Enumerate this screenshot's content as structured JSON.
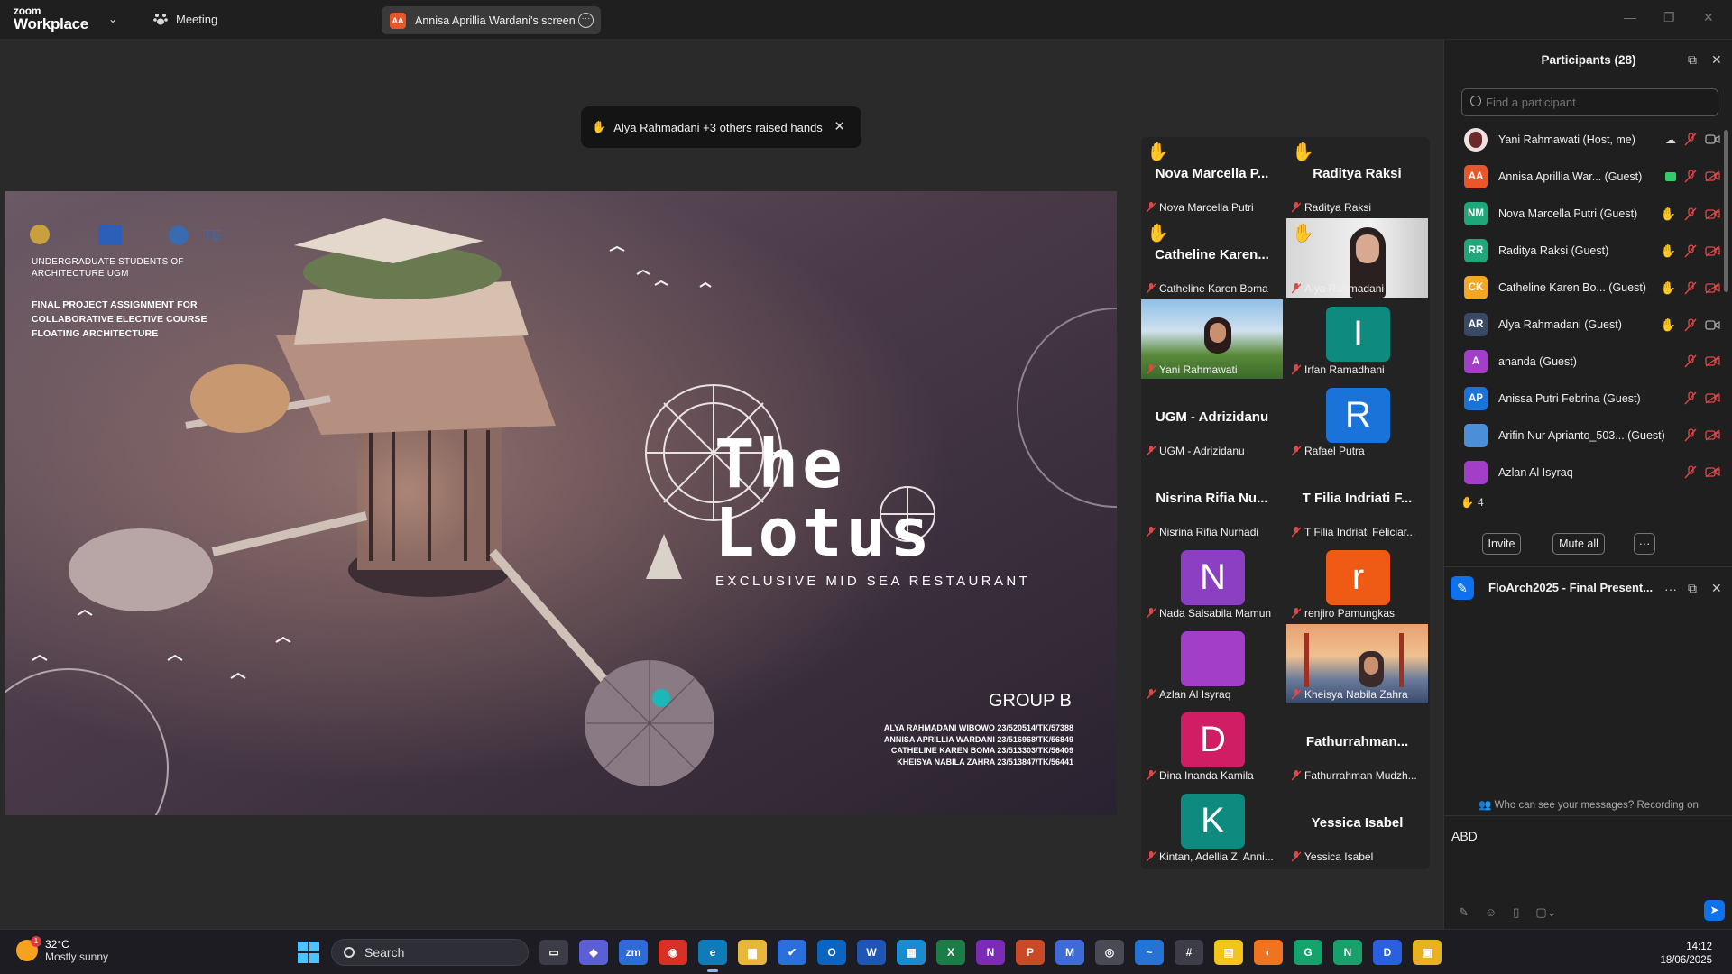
{
  "topbar": {
    "logo_line1": "zoom",
    "logo_line2": "Workplace",
    "meeting_label": "Meeting",
    "screen_tab_initials": "AA",
    "screen_tab_label": "Annisa Aprillia Wardani's screen"
  },
  "toast": {
    "text": "Alya Rahmadani +3 others raised hands"
  },
  "slide": {
    "header_line": "UNDERGRADUATE STUDENTS OF ARCHITECTURE UGM",
    "assignment": "FINAL PROJECT ASSIGNMENT FOR COLLABORATIVE ELECTIVE COURSE FLOATING ARCHITECTURE",
    "title_line1": "The",
    "title_line2": "Lotus",
    "subtitle": "EXCLUSIVE MID SEA RESTAURANT",
    "group": "GROUP B",
    "members": [
      "ALYA RAHMADANI WIBOWO 23/520514/TK/57388",
      "ANNISA APRILLIA WARDANI 23/516968/TK/56849",
      "CATHELINE KAREN BOMA 23/513303/TK/56409",
      "KHEISYA NABILA ZAHRA 23/513847/TK/56441"
    ]
  },
  "tiles": [
    {
      "big": "Nova Marcella P...",
      "name": "Nova Marcella Putri",
      "hand": true
    },
    {
      "big": "Raditya Raksi",
      "name": "Raditya Raksi",
      "hand": true
    },
    {
      "big": "Catheline Karen...",
      "name": "Catheline Karen Boma",
      "hand": true
    },
    {
      "big": "",
      "name": "Alya Rahmadani",
      "hand": true,
      "photo": "person"
    },
    {
      "big": "",
      "name": "Yani Rahmawati",
      "photo": "campus",
      "highlight": true
    },
    {
      "letter": "I",
      "color": "#0e8a7f",
      "name": "Irfan Ramadhani"
    },
    {
      "big": "UGM - Adrizidanu",
      "name": "UGM - Adrizidanu"
    },
    {
      "letter": "R",
      "color": "#1a73d9",
      "name": "Rafael Putra"
    },
    {
      "big": "Nisrina Rifia Nu...",
      "name": "Nisrina Rifia Nurhadi"
    },
    {
      "big": "T Filia Indriati F...",
      "name": "T Filia Indriati Feliciar..."
    },
    {
      "letter": "N",
      "color": "#8c3fc2",
      "name": "Nada Salsabila Mamun"
    },
    {
      "letter": "r",
      "color": "#ef5a14",
      "name": "renjiro Pamungkas"
    },
    {
      "letter": "",
      "color": "#a23ec8",
      "name": "Azlan Al Isyraq"
    },
    {
      "big": "",
      "name": "Kheisya Nabila Zahra",
      "photo": "bridge"
    },
    {
      "letter": "D",
      "color": "#d01d63",
      "name": "Dina Inanda Kamila"
    },
    {
      "big": "Fathurrahman...",
      "name": "Fathurrahman Mudzh..."
    },
    {
      "letter": "K",
      "color": "#0e8a7f",
      "name": "Kintan, Adellia Z, Anni..."
    },
    {
      "big": "Yessica Isabel",
      "name": "Yessica Isabel"
    }
  ],
  "participants_panel": {
    "title": "Participants (28)",
    "search_placeholder": "Find a participant",
    "list": [
      {
        "initials": "",
        "color": "#c84a4a",
        "name": "Yani Rahmawati (Host, me)",
        "photo": true,
        "hand": false,
        "cam_off": false
      },
      {
        "initials": "AA",
        "color": "#e8562a",
        "name": "Annisa Aprillia War... (Guest)",
        "hand": false,
        "sharing": true,
        "cam_off": true
      },
      {
        "initials": "NM",
        "color": "#1fa67a",
        "name": "Nova Marcella Putri (Guest)",
        "hand": true,
        "cam_off": true
      },
      {
        "initials": "RR",
        "color": "#1fa67a",
        "name": "Raditya Raksi  (Guest)",
        "hand": true,
        "cam_off": true
      },
      {
        "initials": "CK",
        "color": "#f5a623",
        "name": "Catheline Karen Bo... (Guest)",
        "hand": true,
        "cam_off": true
      },
      {
        "initials": "AR",
        "color": "#3a4a64",
        "name": "Alya Rahmadani (Guest)",
        "hand": true,
        "cam_off": false
      },
      {
        "initials": "A",
        "color": "#a23ec8",
        "name": "ananda (Guest)",
        "hand": false,
        "cam_off": true
      },
      {
        "initials": "AP",
        "color": "#1a73d9",
        "name": "Anissa Putri Febrina (Guest)",
        "hand": false,
        "cam_off": true
      },
      {
        "initials": "",
        "color": "#4a8fd8",
        "name": "Arifin Nur Aprianto_503... (Guest)",
        "hand": false,
        "cam_off": true
      },
      {
        "initials": "",
        "color": "#a23ec8",
        "name": "Azlan Al Isyraq",
        "hand": false,
        "cam_off": true
      }
    ],
    "hand_count": "4",
    "invite_label": "Invite",
    "mute_all_label": "Mute all",
    "more_label": "···"
  },
  "chat": {
    "title": "FloArch2025 - Final Present...",
    "notice": "Who can see your messages? Recording on",
    "input_value": "ABD"
  },
  "taskbar": {
    "temp": "32°C",
    "weather": "Mostly sunny",
    "weather_badge": "1",
    "search_label": "Search",
    "time": "14:12",
    "date": "18/06/2025",
    "apps": [
      {
        "name": "task-view",
        "color": "#3c3c46",
        "label": "▭"
      },
      {
        "name": "copilot",
        "color": "#5b5fd6",
        "label": "◆"
      },
      {
        "name": "zoom",
        "color": "#2d6bd6",
        "label": "zm"
      },
      {
        "name": "chrome",
        "color": "#d93025",
        "label": "◉"
      },
      {
        "name": "edge",
        "color": "#0f7bb8",
        "label": "e",
        "active": true
      },
      {
        "name": "file-explorer",
        "color": "#e8b73a",
        "label": "▆"
      },
      {
        "name": "todo",
        "color": "#2a6fdb",
        "label": "✔"
      },
      {
        "name": "outlook",
        "color": "#0a64c2",
        "label": "O"
      },
      {
        "name": "word",
        "color": "#1f55b5",
        "label": "W"
      },
      {
        "name": "calendar",
        "color": "#1b8bd1",
        "label": "▦"
      },
      {
        "name": "excel",
        "color": "#1c7c45",
        "label": "X"
      },
      {
        "name": "onenote",
        "color": "#7b2bb5",
        "label": "N"
      },
      {
        "name": "powerpoint",
        "color": "#c84a26",
        "label": "P"
      },
      {
        "name": "m365",
        "color": "#3e6bd8",
        "label": "M"
      },
      {
        "name": "camera",
        "color": "#4a4a55",
        "label": "◎"
      },
      {
        "name": "whiteboard",
        "color": "#2673d6",
        "label": "~"
      },
      {
        "name": "calculator",
        "color": "#3d3d48",
        "label": "#"
      },
      {
        "name": "sticky-notes",
        "color": "#f3c518",
        "label": "▤"
      },
      {
        "name": "firefox",
        "color": "#f07320",
        "label": "◐"
      },
      {
        "name": "grammarly",
        "color": "#15a36b",
        "label": "G"
      },
      {
        "name": "app-green",
        "color": "#18a06b",
        "label": "N"
      },
      {
        "name": "app-blue",
        "color": "#2a5fe0",
        "label": "D"
      },
      {
        "name": "app-yellow",
        "color": "#e8b21f",
        "label": "▣"
      }
    ]
  }
}
